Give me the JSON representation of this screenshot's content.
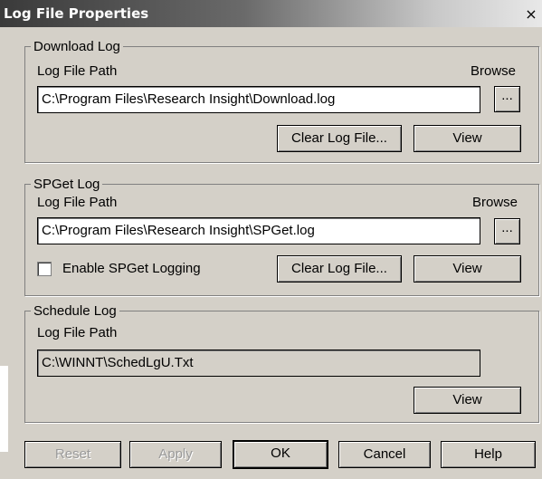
{
  "window": {
    "title": "Log File Properties",
    "close_glyph": "×"
  },
  "download_log": {
    "legend": "Download Log",
    "path_label": "Log File Path",
    "browse_label": "Browse",
    "path_value": "C:\\Program Files\\Research Insight\\Download.log",
    "browse_button": "...",
    "clear_button": "Clear Log File...",
    "view_button": "View"
  },
  "spget_log": {
    "legend": "SPGet Log",
    "path_label": "Log File Path",
    "browse_label": "Browse",
    "path_value": "C:\\Program Files\\Research Insight\\SPGet.log",
    "browse_button": "...",
    "enable_label": "Enable SPGet Logging",
    "enable_checked": false,
    "clear_button": "Clear Log File...",
    "view_button": "View"
  },
  "schedule_log": {
    "legend": "Schedule Log",
    "path_label": "Log File Path",
    "path_value": "C:\\WINNT\\SchedLgU.Txt",
    "view_button": "View"
  },
  "footer": {
    "reset": "Reset",
    "apply": "Apply",
    "ok": "OK",
    "cancel": "Cancel",
    "help": "Help"
  },
  "colors": {
    "dialog_face": "#d4d0c8",
    "title_text": "#ffffff",
    "disabled_text": "#9a9a9a"
  }
}
